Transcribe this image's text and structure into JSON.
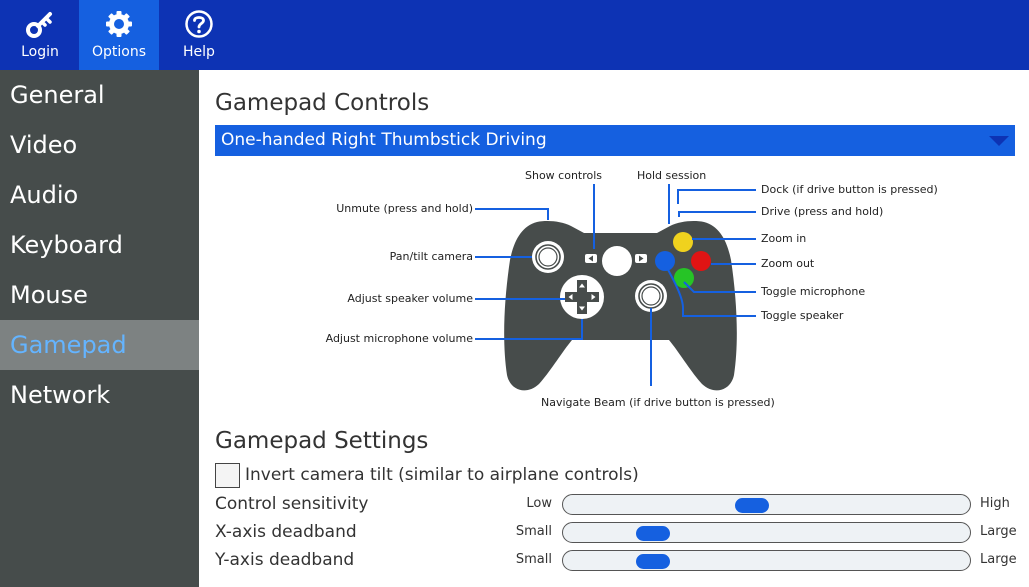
{
  "colors": {
    "topbar": "#0d33b4",
    "accent": "#1560e0",
    "sidebar": "#464c4b",
    "sidebar_active": "#7d8282",
    "sidebar_active_text": "#64b4ff",
    "controller": "#474c4b",
    "button_yellow": "#f0d21e",
    "button_red": "#e01414",
    "button_green": "#26c426",
    "button_blue": "#1560e0"
  },
  "topbar": {
    "buttons": [
      {
        "label": "Login",
        "icon": "key-icon"
      },
      {
        "label": "Options",
        "icon": "gear-icon"
      },
      {
        "label": "Help",
        "icon": "question-circle-icon"
      }
    ],
    "active": "Options"
  },
  "sidebar": {
    "items": [
      {
        "label": "General"
      },
      {
        "label": "Video"
      },
      {
        "label": "Audio"
      },
      {
        "label": "Keyboard"
      },
      {
        "label": "Mouse"
      },
      {
        "label": "Gamepad"
      },
      {
        "label": "Network"
      }
    ],
    "active": "Gamepad"
  },
  "main": {
    "controls_title": "Gamepad Controls",
    "scheme_select": {
      "value": "One-handed Right Thumbstick Driving",
      "icon": "caret-down-icon"
    },
    "diagram": {
      "labels": {
        "show_controls": "Show controls",
        "hold_session": "Hold session",
        "dock": "Dock (if drive button is pressed)",
        "drive": "Drive (press and hold)",
        "unmute": "Unmute (press and hold)",
        "zoom_in": "Zoom in",
        "pan_tilt": "Pan/tilt camera",
        "zoom_out": "Zoom out",
        "toggle_microphone": "Toggle microphone",
        "speaker_volume": "Adjust speaker volume",
        "toggle_speaker": "Toggle speaker",
        "microphone_volume": "Adjust microphone volume",
        "navigate_beam": "Navigate Beam (if drive button is pressed)"
      }
    },
    "settings_title": "Gamepad Settings",
    "invert_tilt": {
      "label": "Invert camera tilt (similar to airplane controls)",
      "checked": false
    },
    "sliders": [
      {
        "label": "Control sensitivity",
        "min_label": "Low",
        "max_label": "High",
        "value": 0.46
      },
      {
        "label": "X-axis deadband",
        "min_label": "Small",
        "max_label": "Large",
        "value": 0.19
      },
      {
        "label": "Y-axis deadband",
        "min_label": "Small",
        "max_label": "Large",
        "value": 0.19
      }
    ]
  }
}
